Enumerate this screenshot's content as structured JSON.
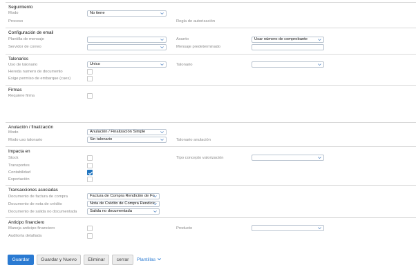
{
  "seguimiento": {
    "title": "Seguimiento",
    "modo_label": "Modo",
    "modo_value": "No tiene",
    "proceso_label": "Proceso",
    "regla_label": "Regla de autorización"
  },
  "email": {
    "title": "Configuración de email",
    "plantilla_label": "Plantilla de mensaje",
    "plantilla_value": "",
    "servidor_label": "Servidor de correo",
    "servidor_value": "",
    "asunto_label": "Asunto",
    "asunto_value": "Usar número de comprobante",
    "mensaje_label": "Mensaje predeterminado"
  },
  "talonarios": {
    "title": "Talonarios",
    "uso_label": "Uso de talonario",
    "uso_value": "Unico",
    "talonario_label": "Talonario",
    "talonario_value": "",
    "hereda_label": "Hereda numero de documento",
    "exige_label": "Exige permiso de embarque (cuex)"
  },
  "firmas": {
    "title": "Firmas",
    "requiere_label": "Requiere firma"
  },
  "anulacion": {
    "title": "Anulación / finalización",
    "modo_label": "Modo",
    "modo_value": "Anulación / Finalización Simple",
    "modo_uso_label": "Modo uso talonario",
    "modo_uso_value": "Sin talonario",
    "talonario_anul_label": "Talonario anulación"
  },
  "impacta": {
    "title": "Impacta en",
    "stock_label": "Stock",
    "transportes_label": "Transportes",
    "contabilidad_label": "Contabilidad",
    "exportacion_label": "Exportación",
    "tipo_label": "Tipo concepto valorización",
    "tipo_value": "",
    "contabilidad_checked": true
  },
  "transacciones": {
    "title": "Transacciones asociadas",
    "factura_label": "Documento de factura de compra",
    "factura_value": "Factura de Compra Rendición de Fo",
    "nota_label": "Documento de nota de crédito",
    "nota_value": "Nota de Crédito de Compra Rendicic",
    "salida_label": "Documento de salida no documentada",
    "salida_value": "Salida no documentada"
  },
  "anticipo": {
    "title": "Anticipo financiero",
    "maneja_label": "Maneja anticipo financiero",
    "auditoria_label": "Auditoría detallada",
    "producto_label": "Producto",
    "producto_value": ""
  },
  "buttons": {
    "guardar": "Guardar",
    "guardar_nuevo": "Guardar y Nuevo",
    "eliminar": "Eliminar",
    "cerrar": "cerrar",
    "plantillas": "Plantillas"
  },
  "colors": {
    "accent": "#2a7ad2",
    "checked": "#1e73be"
  }
}
